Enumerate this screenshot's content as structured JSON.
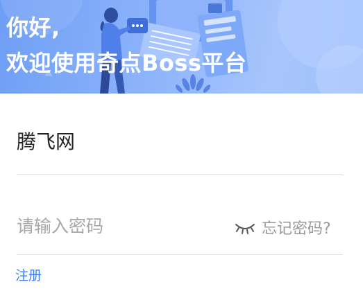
{
  "banner": {
    "greeting_line1": "你好,",
    "greeting_line2": "欢迎使用奇点Boss平台"
  },
  "form": {
    "company_name": "腾飞网",
    "password_placeholder": "请输入密码",
    "password_value": "",
    "forgot_password_label": "忘记密码?",
    "register_label": "注册"
  },
  "icons": {
    "password_visibility": "eye-closed-icon"
  },
  "colors": {
    "banner_start": "#6e9ef5",
    "banner_end": "#a7c5fd",
    "link_accent": "#3d7ef0",
    "divider": "#e1e1e1",
    "placeholder": "#a8a8a8"
  }
}
